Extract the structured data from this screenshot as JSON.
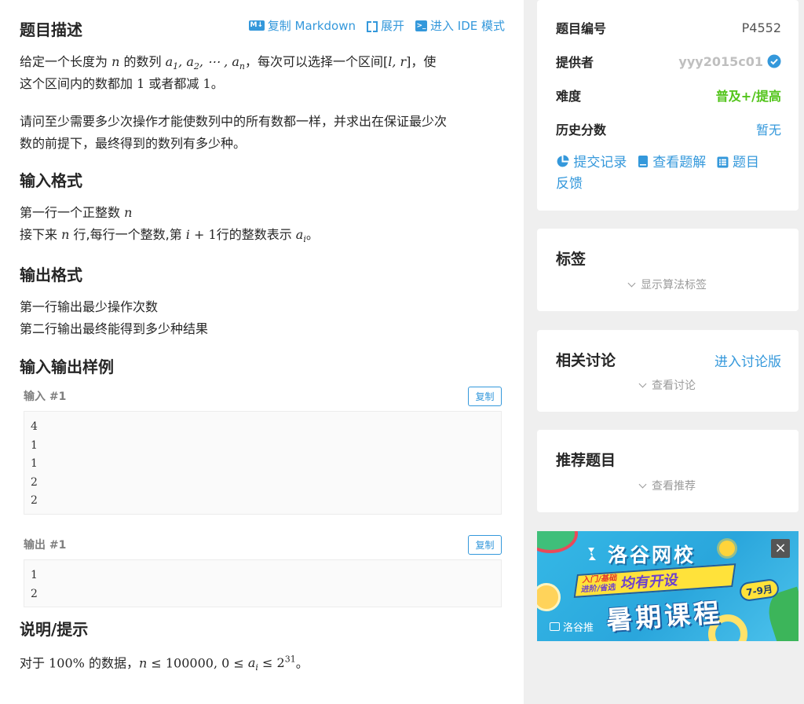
{
  "toolbar": {
    "copy_markdown": "复制 Markdown",
    "expand": "展开",
    "ide_mode": "进入 IDE 模式"
  },
  "problem": {
    "desc_title": "题目描述",
    "desc_line1_a": "给定一个长度为",
    "desc_line1_b": "的数列",
    "desc_line1_c": "，每次可以选择一个区间",
    "desc_line1_d": "，使",
    "desc_line2_a": "这个区间内的数都加",
    "desc_line2_b": "或者都减",
    "desc_line2_c": "。",
    "desc_line3": "请问至少需要多少次操作才能使数列中的所有数都一样，并求出在保证最少次",
    "desc_line4": "数的前提下，最终得到的数列有多少种。",
    "input_title": "输入格式",
    "input_line1": "第一行一个正整数",
    "input_line2_a": "接下来",
    "input_line2_b": "行,每行一个整数,第",
    "input_line2_c": "行的整数表示",
    "input_line2_d": "。",
    "output_title": "输出格式",
    "output_line1": "第一行输出最少操作次数",
    "output_line2": "第二行输出最终能得到多少种结果",
    "samples_title": "输入输出样例",
    "hint_title": "说明/提示",
    "hint_a": "对于",
    "hint_b": "的数据，",
    "hint_c": "。"
  },
  "samples": {
    "input_label": "输入 #1",
    "output_label": "输出 #1",
    "copy_label": "复制",
    "input_lines": [
      "4",
      "1",
      "1",
      "2",
      "2"
    ],
    "output_lines": [
      "1",
      "2"
    ]
  },
  "info": {
    "id_label": "题目编号",
    "id_value": "P4552",
    "provider_label": "提供者",
    "provider_value": "yyy2015c01",
    "difficulty_label": "难度",
    "difficulty_value": "普及+/提高",
    "history_label": "历史分数",
    "history_value": "暂无",
    "submit_records": "提交记录",
    "view_solutions": "查看题解",
    "feedback_a": "题目",
    "feedback_b": "反馈"
  },
  "tags": {
    "title": "标签",
    "toggle": "显示算法标签"
  },
  "discussion": {
    "title": "相关讨论",
    "link": "进入讨论版",
    "toggle": "查看讨论"
  },
  "recommend": {
    "title": "推荐题目",
    "toggle": "查看推荐"
  },
  "ad": {
    "brand": "洛谷网校",
    "ribbon_a": "入门/基础",
    "ribbon_b": "进阶/省选",
    "ribbon_c": "均有开设",
    "months": "7-9月",
    "headline": "暑期课程",
    "footer": "洛谷推",
    "close": "×"
  },
  "colors": {
    "accent": "#3498db",
    "difficulty": "#52c41a",
    "verified": "#3498db"
  }
}
